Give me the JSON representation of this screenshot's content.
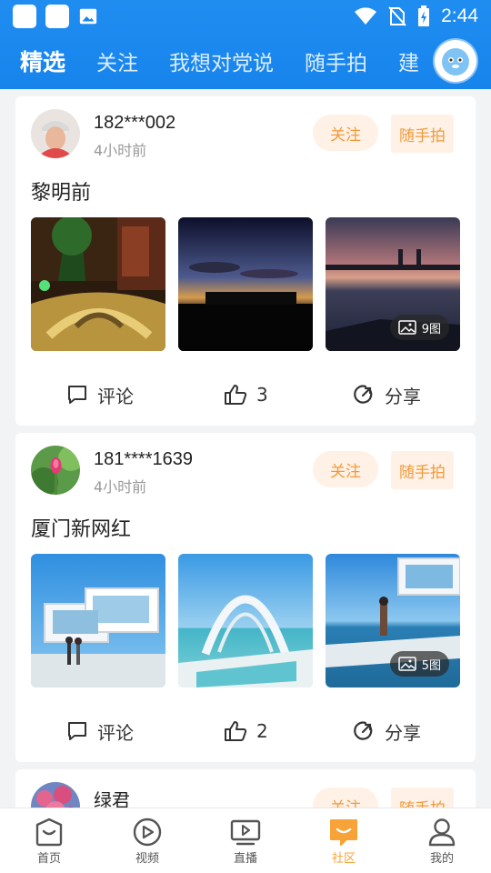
{
  "status": {
    "time": "2:44"
  },
  "tabs": [
    {
      "label": "精选",
      "active": true
    },
    {
      "label": "关注",
      "active": false
    },
    {
      "label": "我想对党说",
      "active": false
    },
    {
      "label": "随手拍",
      "active": false
    },
    {
      "label": "建",
      "active": false
    }
  ],
  "posts": [
    {
      "username": "182***002",
      "time": "4小时前",
      "follow_label": "关注",
      "topic_label": "随手拍",
      "title": "黎明前",
      "image_count": "9图",
      "comment_label": "评论",
      "likes": "3",
      "share_label": "分享"
    },
    {
      "username": "181****1639",
      "time": "4小时前",
      "follow_label": "关注",
      "topic_label": "随手拍",
      "title": "厦门新网红",
      "image_count": "5图",
      "comment_label": "评论",
      "likes": "2",
      "share_label": "分享"
    },
    {
      "username": "绿君",
      "follow_label": "关注",
      "topic_label": "随手拍"
    }
  ],
  "bottom_nav": [
    {
      "label": "首页",
      "icon": "home-icon"
    },
    {
      "label": "视频",
      "icon": "play-icon"
    },
    {
      "label": "直播",
      "icon": "tv-icon"
    },
    {
      "label": "社区",
      "icon": "community-icon",
      "active": true
    },
    {
      "label": "我的",
      "icon": "profile-icon"
    }
  ],
  "colors": {
    "brand_blue": "#1784ec",
    "accent_orange": "#f29a3a"
  }
}
